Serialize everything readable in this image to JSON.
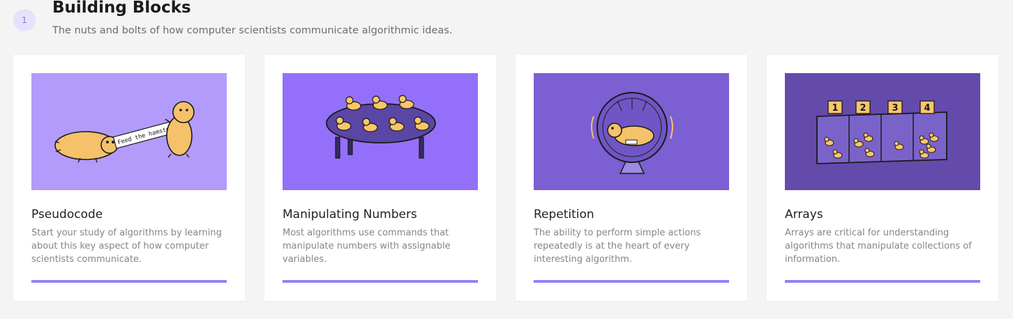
{
  "section": {
    "step_number": "1",
    "title": "Building Blocks",
    "subtitle": "The nuts and bolts of how computer scientists communicate algorithmic ideas."
  },
  "cards": [
    {
      "title": "Pseudocode",
      "description": "Start your study of algorithms by learning about this key aspect of how computer scientists communicate.",
      "illustration": "hamsters-feed-the-hamster-banner",
      "banner_text": "Feed the hamster",
      "background": "#b39bfb",
      "progress": 1.0
    },
    {
      "title": "Manipulating Numbers",
      "description": "Most algorithms use commands that manipulate numbers with assignable variables.",
      "illustration": "ducks-on-table",
      "background": "#9470fa",
      "progress": 1.0
    },
    {
      "title": "Repetition",
      "description": "The ability to perform simple actions repeatedly is at the heart of every interesting algorithm.",
      "illustration": "hamster-in-wheel",
      "background": "#7b5fd3",
      "progress": 1.0
    },
    {
      "title": "Arrays",
      "description": "Arrays are critical for understanding algorithms that manipulate collections of information.",
      "illustration": "numbered-bins-with-ducks",
      "bin_labels": [
        "1",
        "2",
        "3",
        "4"
      ],
      "background": "#644aab",
      "progress": 1.0
    }
  ],
  "colors": {
    "accent": "#9a7ff0",
    "duck": "#f9c66a",
    "hamster": "#f5c16b"
  }
}
